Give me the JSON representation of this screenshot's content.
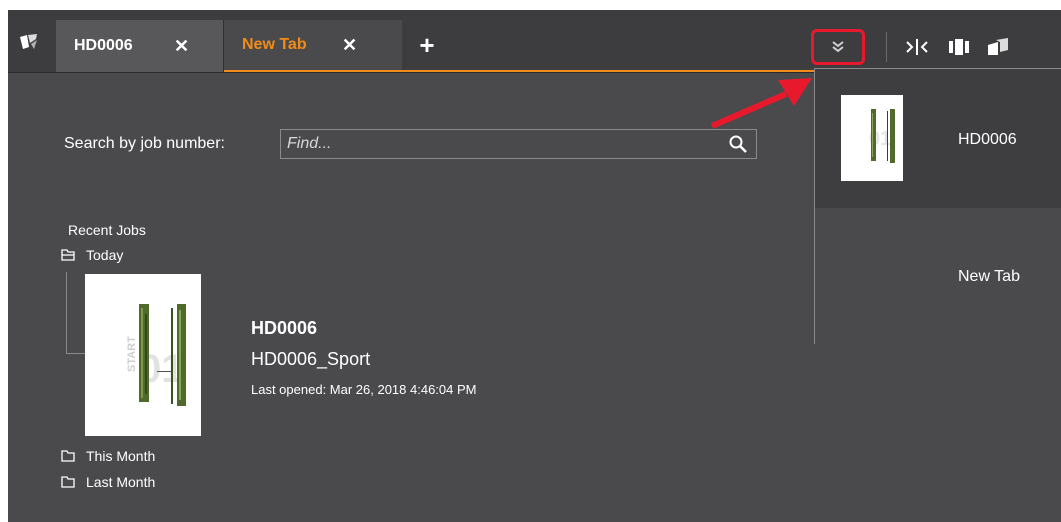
{
  "tabs": [
    {
      "label": "HD0006",
      "active": false
    },
    {
      "label": "New Tab",
      "active": true
    }
  ],
  "tab_close_glyph": "✕",
  "add_tab_glyph": "+",
  "overflow_glyph": "»",
  "icons": {
    "app": "app-logo-icon",
    "overflow": "double-chevron-down-icon",
    "split_view": "split-view-icon",
    "panel_view": "panel-view-icon",
    "undock": "undock-window-icon",
    "search": "search-icon",
    "folder": "folder-icon"
  },
  "search": {
    "label": "Search by job number:",
    "placeholder": "Find..."
  },
  "recent": {
    "title": "Recent Jobs",
    "groups": [
      "Today",
      "This Month",
      "Last Month"
    ]
  },
  "job": {
    "id": "HD0006",
    "name": "HD0006_Sport",
    "last_opened": "Last opened: Mar 26, 2018 4:46:04 PM",
    "thumb_text": "START",
    "thumb_number": "01"
  },
  "dropdown": {
    "items": [
      {
        "label": "HD0006"
      },
      {
        "label": "New Tab"
      }
    ]
  },
  "colors": {
    "accent": "#f08c1a",
    "highlight": "#e8192c",
    "background": "#4a4a4d",
    "tabbar": "#3d3d40"
  }
}
